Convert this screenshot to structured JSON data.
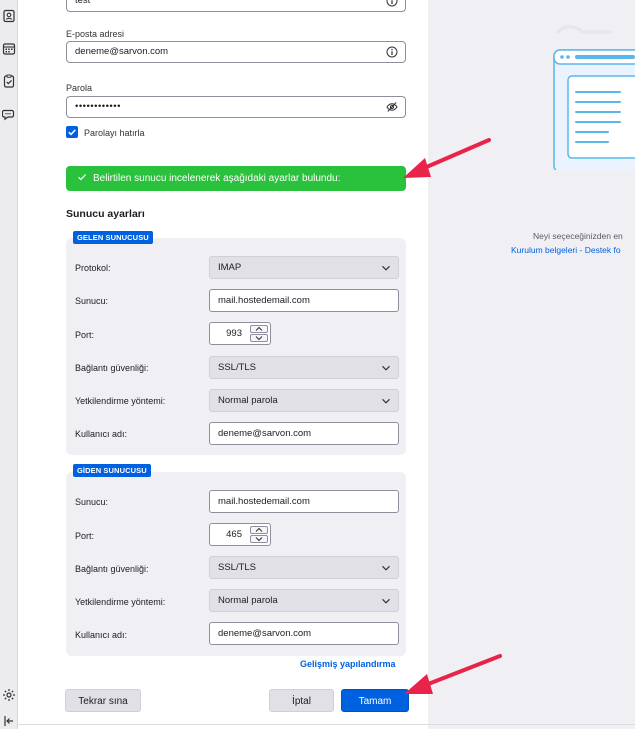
{
  "colors": {
    "accent": "#0061e0",
    "success": "#2ac13c",
    "annotation_arrow": "#e8244a"
  },
  "spaces_toolbar": {
    "icons": [
      "address-book-icon",
      "calendar-icon",
      "tasks-icon",
      "chat-icon",
      "settings-icon",
      "collapse-icon"
    ]
  },
  "account": {
    "name_value": "test",
    "email_label": "E-posta adresi",
    "email_value": "deneme@sarvon.com",
    "password_label": "Parola",
    "password_value": "••••••••••••",
    "remember_password_label": "Parolayı hatırla",
    "remember_password_checked": true
  },
  "status_banner": {
    "text": "Belirtilen sunucu incelenerek aşağıdaki ayarlar bulundu:"
  },
  "server_settings": {
    "title": "Sunucu ayarları",
    "incoming": {
      "badge": "GELEN SUNUCUSU",
      "protocol_label": "Protokol:",
      "protocol_value": "IMAP",
      "server_label": "Sunucu:",
      "server_value": "mail.hostedemail.com",
      "port_label": "Port:",
      "port_value": "993",
      "security_label": "Bağlantı güvenliği:",
      "security_value": "SSL/TLS",
      "auth_label": "Yetkilendirme yöntemi:",
      "auth_value": "Normal parola",
      "username_label": "Kullanıcı adı:",
      "username_value": "deneme@sarvon.com"
    },
    "outgoing": {
      "badge": "GİDEN SUNUCUSU",
      "server_label": "Sunucu:",
      "server_value": "mail.hostedemail.com",
      "port_label": "Port:",
      "port_value": "465",
      "security_label": "Bağlantı güvenliği:",
      "security_value": "SSL/TLS",
      "auth_label": "Yetkilendirme yöntemi:",
      "auth_value": "Normal parola",
      "username_label": "Kullanıcı adı:",
      "username_value": "deneme@sarvon.com"
    },
    "advanced_link": "Gelişmiş yapılandırma"
  },
  "buttons": {
    "retest": "Tekrar sına",
    "cancel": "İptal",
    "done": "Tamam"
  },
  "help_panel": {
    "text": "Neyi seçeceğinizden en",
    "links": "Kurulum belgeleri - Destek fo"
  }
}
